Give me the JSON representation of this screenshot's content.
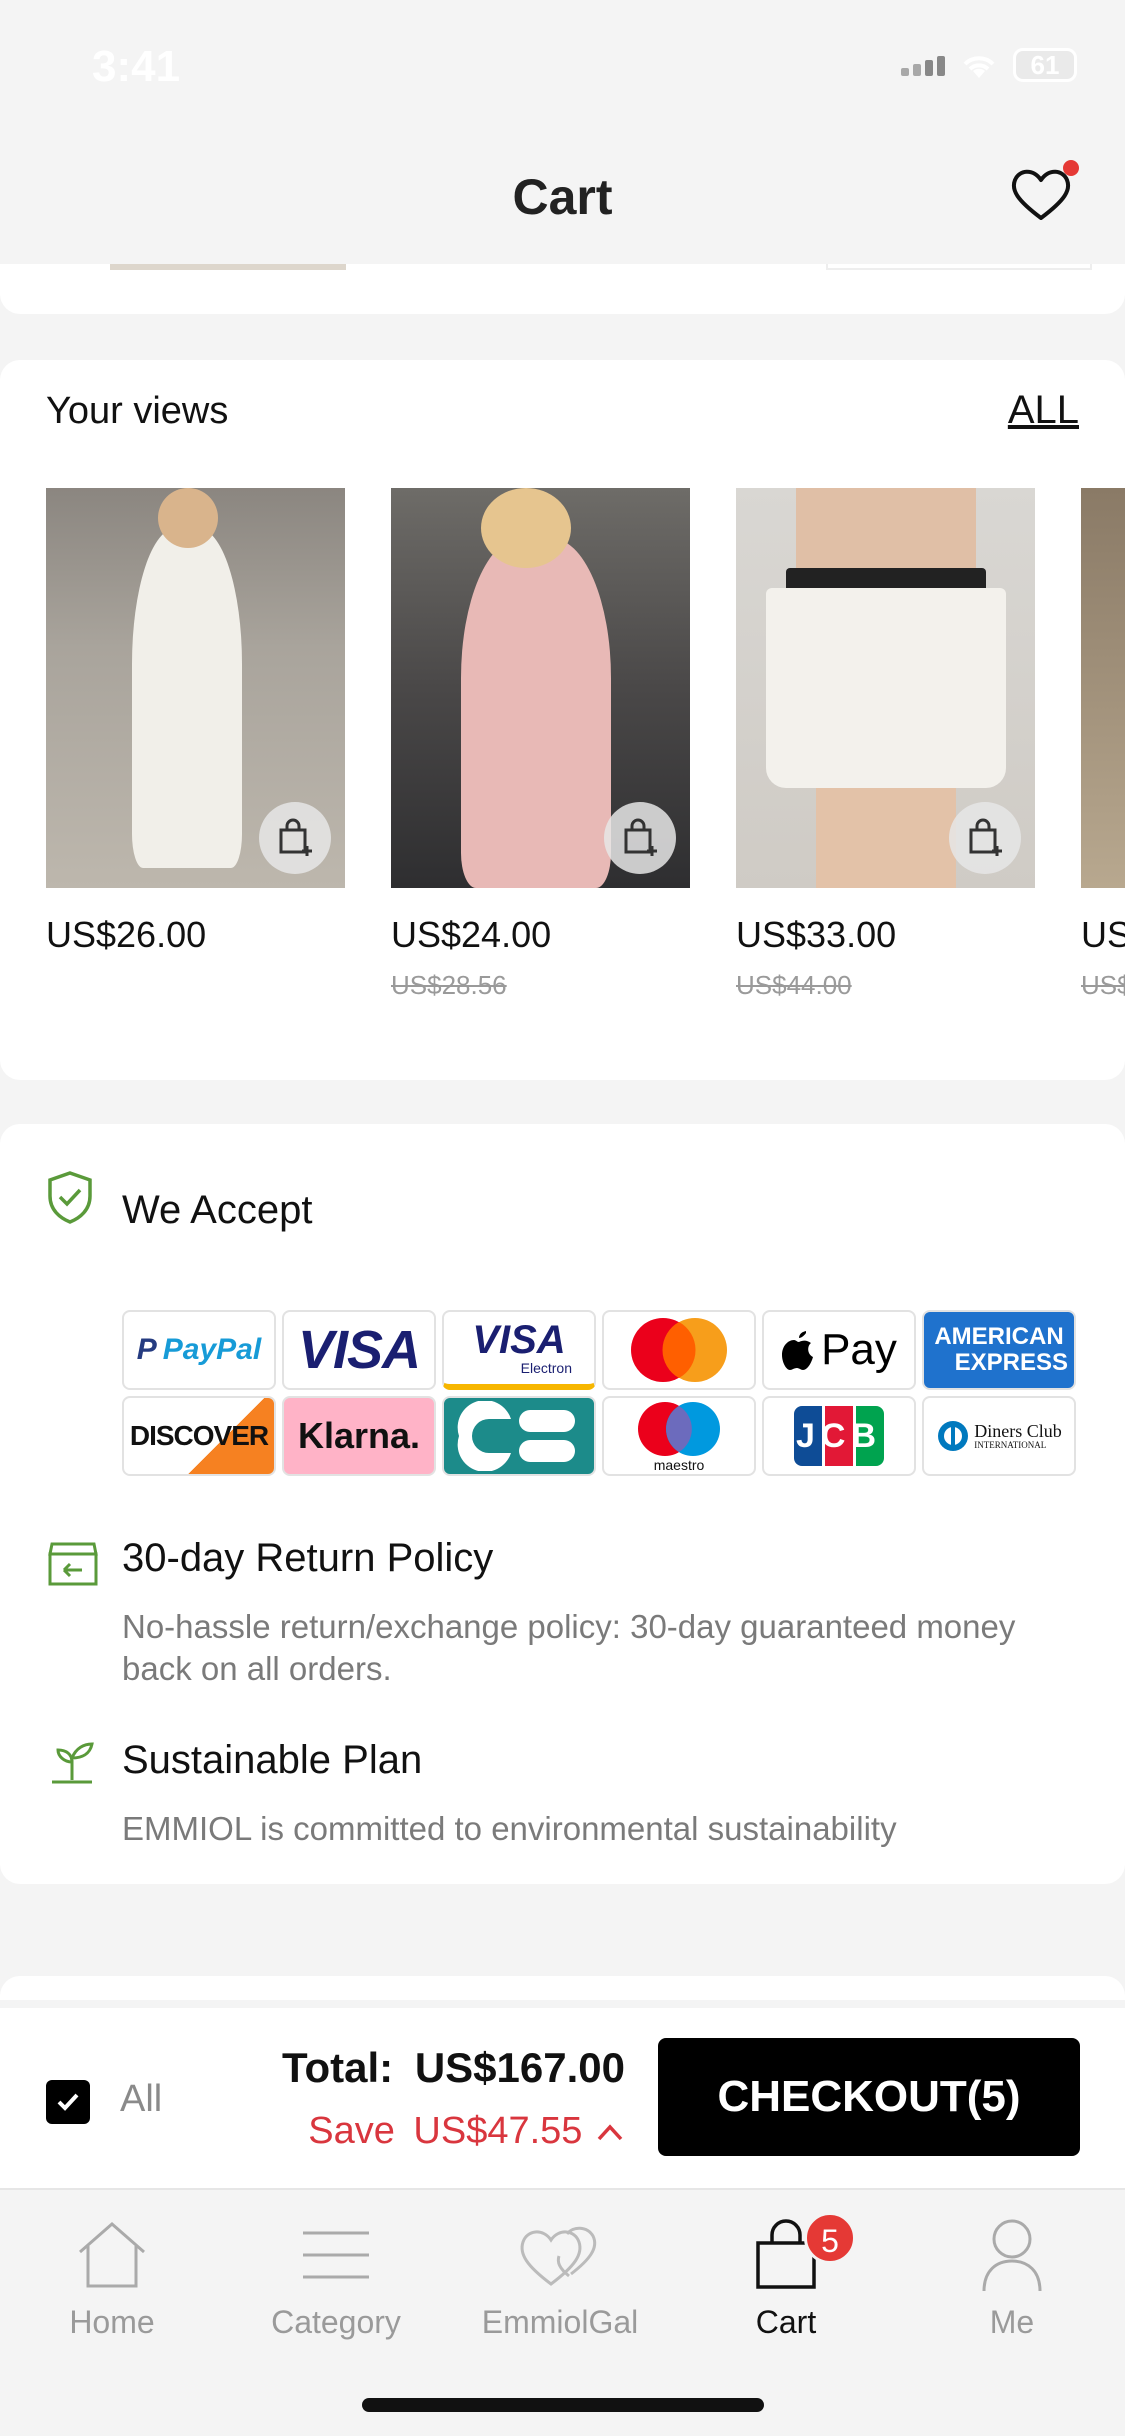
{
  "status": {
    "time": "3:41",
    "battery": "61"
  },
  "header": {
    "title": "Cart"
  },
  "views": {
    "title": "Your views",
    "all_label": "ALL",
    "products": [
      {
        "price": "US$26.00",
        "old_price": ""
      },
      {
        "price": "US$24.00",
        "old_price": "US$28.56"
      },
      {
        "price": "US$33.00",
        "old_price": "US$44.00"
      },
      {
        "price": "US",
        "old_price": "US$"
      }
    ]
  },
  "accept": {
    "title": "We Accept",
    "methods": [
      "PayPal",
      "VISA",
      "VISA Electron",
      "Mastercard",
      "Apple Pay",
      "American Express",
      "DISCOVER",
      "Klarna.",
      "CB",
      "maestro",
      "JCB",
      "Diners Club International"
    ],
    "paypal_label": "PayPal",
    "visa_label": "VISA",
    "visa_electron_label": "VISA",
    "electron_sub": "Electron",
    "applepay_label": "Pay",
    "amex_line1": "AMERICAN",
    "amex_line2": "EXPRESS",
    "discover_label": "DISCOVER",
    "klarna_label": "Klarna.",
    "maestro_label": "maestro",
    "jcb_label": "JCB",
    "diners_line1": "Diners Club",
    "diners_line2": "INTERNATIONAL"
  },
  "return_policy": {
    "title": "30-day Return Policy",
    "desc": "No-hassle return/exchange policy: 30-day guaranteed money back on all orders."
  },
  "sustainable": {
    "title": "Sustainable Plan",
    "desc": "EMMIOL is committed to environmental sustainability"
  },
  "checkout": {
    "all_label": "All",
    "total_label": "Total:",
    "total_value": "US$167.00",
    "save_label": "Save",
    "save_value": "US$47.55",
    "button_label": "CHECKOUT(5)"
  },
  "tabbar": {
    "home": "Home",
    "category": "Category",
    "emmiolgal": "EmmiolGal",
    "cart": "Cart",
    "cart_badge": "5",
    "me": "Me"
  },
  "colors": {
    "accent": "#000000",
    "save": "#d9363e",
    "badge": "#e53935",
    "shield": "#5a9a3a"
  }
}
